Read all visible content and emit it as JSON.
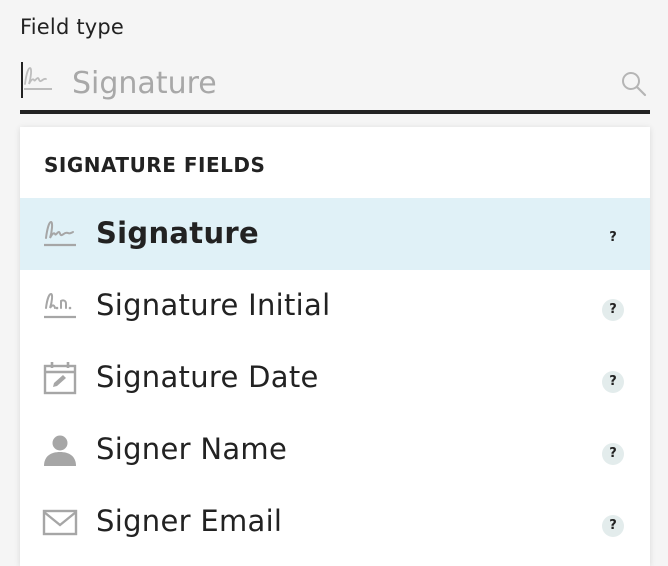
{
  "field": {
    "label": "Field type",
    "input_value": "Signature"
  },
  "dropdown": {
    "section_header": "SIGNATURE FIELDS",
    "items": [
      {
        "label": "Signature",
        "icon": "signature-icon",
        "selected": true,
        "help": "?"
      },
      {
        "label": "Signature Initial",
        "icon": "initials-icon",
        "selected": false,
        "help": "?"
      },
      {
        "label": "Signature Date",
        "icon": "calendar-icon",
        "selected": false,
        "help": "?"
      },
      {
        "label": "Signer Name",
        "icon": "person-icon",
        "selected": false,
        "help": "?"
      },
      {
        "label": "Signer Email",
        "icon": "envelope-icon",
        "selected": false,
        "help": "?"
      }
    ]
  },
  "colors": {
    "selected_background": "#e0f1f7",
    "icon_gray": "#a6a6a6",
    "text": "#222222",
    "placeholder": "#a8a8a8"
  }
}
